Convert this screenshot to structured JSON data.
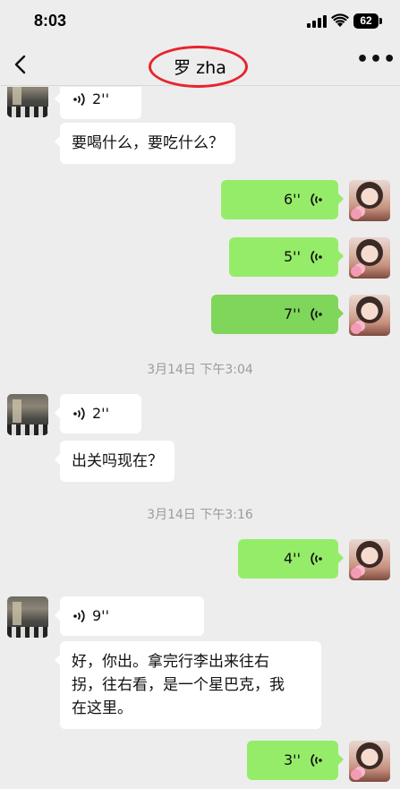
{
  "status_bar": {
    "time": "8:03",
    "battery": "62",
    "icons": [
      "signal-icon",
      "wifi-icon",
      "battery-icon"
    ]
  },
  "nav": {
    "title": "罗 zha",
    "back_icon": "chevron-left-icon",
    "more_icon": "more-dots-icon",
    "more_label": "•••",
    "annotation_color": "#e8242e"
  },
  "colors": {
    "background": "#ededed",
    "incoming_bubble": "#ffffff",
    "outgoing_bubble": "#95ec69",
    "timestamp": "#9b9b9b"
  },
  "messages": {
    "m1": {
      "side": "in",
      "type": "voice",
      "duration": "2''"
    },
    "m2": {
      "side": "in",
      "type": "text",
      "text": "要喝什么，要吃什么？"
    },
    "m3": {
      "side": "out",
      "type": "voice",
      "duration": "6''"
    },
    "m4": {
      "side": "out",
      "type": "voice",
      "duration": "5''"
    },
    "m5": {
      "side": "out",
      "type": "voice",
      "duration": "7''"
    },
    "ts1": "3月14日 下午3:04",
    "m6": {
      "side": "in",
      "type": "voice",
      "duration": "2''"
    },
    "m7": {
      "side": "in",
      "type": "text",
      "text": "出关吗现在？"
    },
    "ts2": "3月14日 下午3:16",
    "m8": {
      "side": "out",
      "type": "voice",
      "duration": "4''"
    },
    "m9": {
      "side": "in",
      "type": "voice",
      "duration": "9''"
    },
    "m10": {
      "side": "in",
      "type": "text",
      "line1": "好，你出。拿完行李出来往右",
      "line2": "拐，往右看，是一个星巴克，我",
      "line3": "在这里。"
    },
    "m11": {
      "side": "out",
      "type": "voice",
      "duration": "3''"
    }
  }
}
